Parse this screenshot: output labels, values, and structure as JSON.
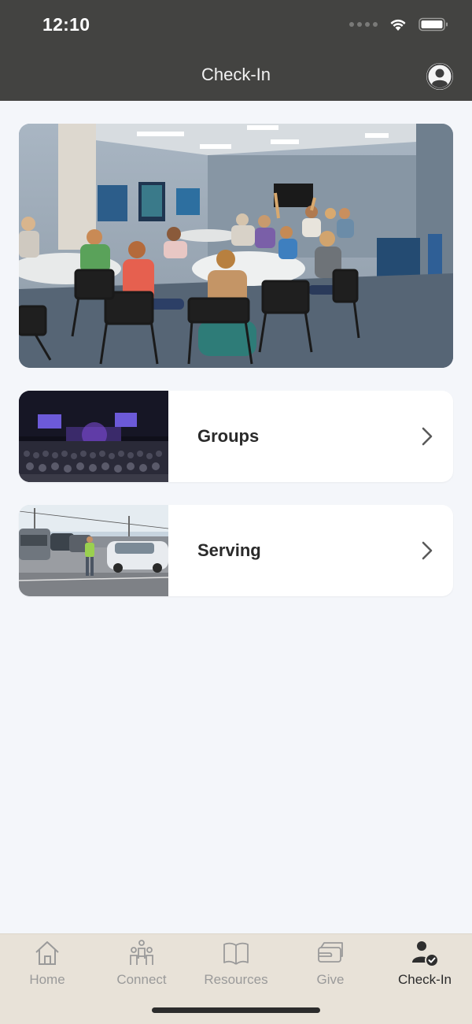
{
  "status_bar": {
    "time": "12:10"
  },
  "header": {
    "title": "Check-In"
  },
  "hero": {
    "icon": "kids-classroom-photo"
  },
  "cards": [
    {
      "label": "Groups",
      "icon": "worship-auditorium-photo"
    },
    {
      "label": "Serving",
      "icon": "parking-lot-volunteer-photo"
    }
  ],
  "tabs": [
    {
      "label": "Home",
      "icon": "home-icon",
      "active": false
    },
    {
      "label": "Connect",
      "icon": "people-icon",
      "active": false
    },
    {
      "label": "Resources",
      "icon": "book-icon",
      "active": false
    },
    {
      "label": "Give",
      "icon": "wallet-icon",
      "active": false
    },
    {
      "label": "Check-In",
      "icon": "check-in-person-icon",
      "active": true
    }
  ],
  "colors": {
    "header_bg": "#434341",
    "page_bg": "#f4f6fa",
    "tabbar_bg": "#e8e2d8",
    "tab_inactive": "#9a9a9a",
    "tab_active": "#2b2b2b"
  }
}
